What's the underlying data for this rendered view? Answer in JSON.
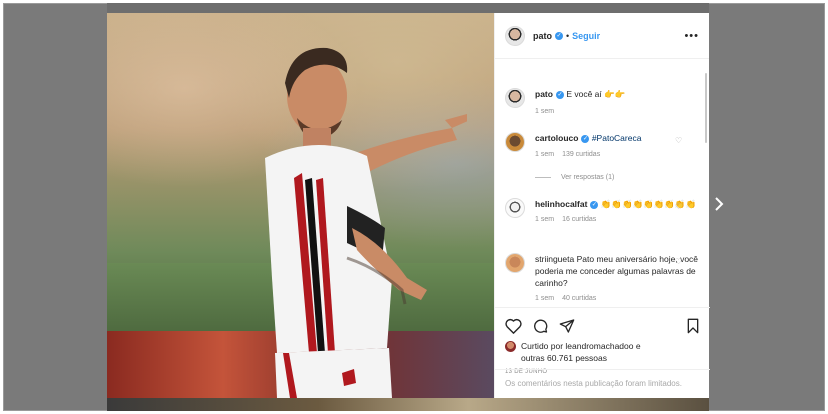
{
  "header": {
    "username": "pato",
    "follow_label": "Seguir",
    "dot": "•",
    "more": "•••"
  },
  "comments": [
    {
      "user": "pato",
      "text": "E você aí 👉👉",
      "time": "1 sem",
      "likes": ""
    },
    {
      "user": "cartolouco",
      "text": "#PatoCareca",
      "time": "1 sem",
      "likes": "139 curtidas"
    },
    {
      "user": "helinhocalfat",
      "text": "👏👏👏👏👏👏👏👏👏",
      "time": "1 sem",
      "likes": "16 curtidas"
    },
    {
      "user": "striingueta",
      "text": "Pato meu aniversário hoje, você poderia me conceder algumas palavras de carinho?",
      "time": "1 sem",
      "likes": "40 curtidas"
    }
  ],
  "replies_label": "Ver respostas (1)",
  "likes_block": {
    "prefix": "Curtido por ",
    "user": "leandromachadoo",
    "middle": " e",
    "line2": "outras 60.761 pessoas"
  },
  "date": "13 DE JUNHO",
  "limited_note": "Os comentários nesta publicação foram limitados.",
  "colors": {
    "accent": "#3897f0",
    "overlay": "#7a7a7a"
  },
  "icons": [
    "heart-icon",
    "comment-icon",
    "share-icon",
    "bookmark-icon",
    "verified-icon",
    "chevron-right-icon"
  ]
}
